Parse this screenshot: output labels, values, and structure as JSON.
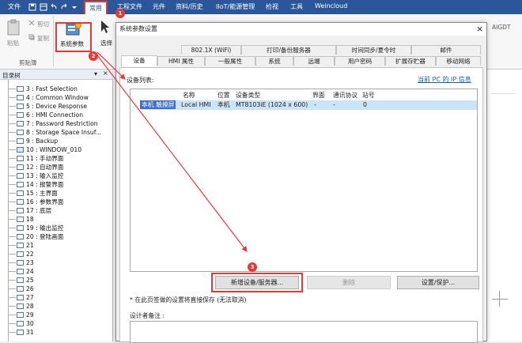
{
  "menubar": {
    "items": [
      "文件",
      "常用",
      "工程文件",
      "元件",
      "资料/历史",
      "IIoT/能源管理",
      "检视",
      "工具",
      "Weincloud"
    ]
  },
  "ribbon": {
    "paste_label": "粘贴",
    "cut_label": "剪切",
    "copy_label": "复制",
    "sysparam_label": "系统参数",
    "select_label": "选择",
    "clipboard_group": "剪贴簿",
    "right_label": "AIGDT"
  },
  "tree": {
    "header": "目录树",
    "items": [
      {
        "num": "3",
        "label": "3 : Fast Selection"
      },
      {
        "num": "4",
        "label": "4 : Common Window"
      },
      {
        "num": "5",
        "label": "5 : Device Response"
      },
      {
        "num": "6",
        "label": "6 : HMI Connection"
      },
      {
        "num": "7",
        "label": "7 : Password Restriction"
      },
      {
        "num": "8",
        "label": "8 : Storage Space Insuf..."
      },
      {
        "num": "9",
        "label": "9 : Backup"
      },
      {
        "num": "10",
        "label": "10 : WINDOW_010"
      },
      {
        "num": "11",
        "label": "11 : 手动界面"
      },
      {
        "num": "12",
        "label": "12 : 自动界面"
      },
      {
        "num": "13",
        "label": "13 : 输入监控"
      },
      {
        "num": "14",
        "label": "14 : 报警界面"
      },
      {
        "num": "15",
        "label": "15 : 主界面"
      },
      {
        "num": "16",
        "label": "16 : 参数界面"
      },
      {
        "num": "17",
        "label": "17 : 底层"
      },
      {
        "num": "18",
        "label": "18"
      },
      {
        "num": "19",
        "label": "19 : 输出监控"
      },
      {
        "num": "20",
        "label": "20 : 登陆画面"
      },
      {
        "num": "21",
        "label": "21"
      },
      {
        "num": "22",
        "label": "22"
      },
      {
        "num": "23",
        "label": "23"
      },
      {
        "num": "24",
        "label": "24"
      },
      {
        "num": "25",
        "label": "25"
      },
      {
        "num": "26",
        "label": "26"
      },
      {
        "num": "27",
        "label": "27"
      },
      {
        "num": "28",
        "label": "28"
      },
      {
        "num": "29",
        "label": "29"
      },
      {
        "num": "30",
        "label": "30"
      },
      {
        "num": "31",
        "label": "31"
      }
    ]
  },
  "dialog": {
    "title": "系统参数设置",
    "tabs_row1": [
      "802.1X (WiFi)",
      "打印/备份服务器",
      "时间同步/夏令时",
      "邮件"
    ],
    "tabs_row2": [
      "设备",
      "HMI 属性",
      "一般属性",
      "系统",
      "远端",
      "用户密码",
      "扩展存贮器",
      "移动网络"
    ],
    "device_list_label": "设备列表:",
    "current_pc_ip_link": "当前 PC 的 IP 信息",
    "columns": [
      "名称",
      "位置",
      "设备类型",
      "界面",
      "通讯协议",
      "站号"
    ],
    "rows": [
      {
        "name_prefix": "本机 触摸屏",
        "name": "Local HMI",
        "location": "本机",
        "type": "MT8103iE (1024 x 600)",
        "interface": "-",
        "protocol": "-",
        "station": "0"
      }
    ],
    "new_device_button": "新增设备/服务器...",
    "delete_button": "删除",
    "settings_button": "设置/保护...",
    "note": "* 在此页签做的设置将直接保存 (无法取消)",
    "designer_note_label": "设计者备注 :"
  },
  "annotations": {
    "badge1": "1",
    "badge2": "2",
    "badge3": "3"
  },
  "colors": {
    "menubar": "#2b579a",
    "highlight": "#e53935",
    "selected_row": "#cce4f7"
  }
}
